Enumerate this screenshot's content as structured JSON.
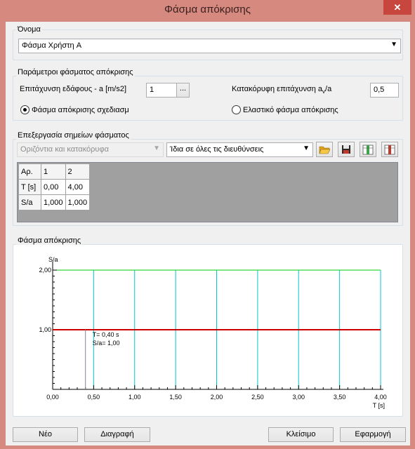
{
  "window": {
    "title": "Φάσμα απόκρισης",
    "close_glyph": "✕"
  },
  "name_group": {
    "label": "Όνομα",
    "selected": "Φάσμα Χρήστη A"
  },
  "params_group": {
    "label": "Παράμετροι φάσματος απόκρισης",
    "ground_accel_label": "Επιτάχυνση εδάφους - a [m/s2]",
    "ground_accel_value": "1",
    "browse_label": "...",
    "vertical_accel_label_prefix": "Κατακόρυφη επιτάχυνση a",
    "vertical_accel_label_sub": "v",
    "vertical_accel_label_suffix": "/a",
    "vertical_accel_value": "0,5",
    "radio_design_label": "Φάσμα απόκρισης σχεδιασμ",
    "radio_elastic_label": "Ελαστικό φάσμα απόκρισης",
    "selected_radio": "design"
  },
  "points_group": {
    "label": "Επεξεργασία σημείων φάσματος",
    "direction_combo": "Οριζόντια και κατακόρυφα",
    "same_combo": "Ίδια σε όλες τις διευθύνσεις",
    "table": {
      "rows": [
        [
          "Αρ.",
          "1",
          "2"
        ],
        [
          "T [s]",
          "0,00",
          "4,00"
        ],
        [
          "S/a",
          "1,000",
          "1,000"
        ]
      ]
    }
  },
  "spectrum_group": {
    "label": "Φάσμα απόκρισης"
  },
  "chart_data": {
    "type": "line",
    "ylabel": "S/a",
    "xlabel": "T [s]",
    "xlim": [
      0,
      4
    ],
    "ylim": [
      0,
      2
    ],
    "xticks": [
      "0,00",
      "0,50",
      "1,00",
      "1,50",
      "2,00",
      "2,50",
      "3,00",
      "3,50",
      "4,00"
    ],
    "yticks": [
      "1,00",
      "2,00"
    ],
    "series": [
      {
        "x": [
          0,
          4
        ],
        "y": [
          1.0,
          1.0
        ],
        "color": "#cc0000"
      }
    ],
    "cursor": {
      "x": 0.4,
      "y": 1.0,
      "text_t": "T= 0,40 s",
      "text_sa": "S/a= 1,00"
    },
    "grid": true,
    "colors": {
      "grid": "#00c8d2",
      "top_line": "#00c800",
      "series": "#cc0000",
      "axis": "#000000"
    }
  },
  "buttons": {
    "new": "Νέο",
    "delete": "Διαγραφή",
    "close": "Κλείσιμο",
    "apply": "Εφαρμογή"
  },
  "icons": {
    "open": "folder-open-icon",
    "save": "save-icon",
    "insert": "insert-column-icon",
    "delete": "delete-column-icon"
  }
}
